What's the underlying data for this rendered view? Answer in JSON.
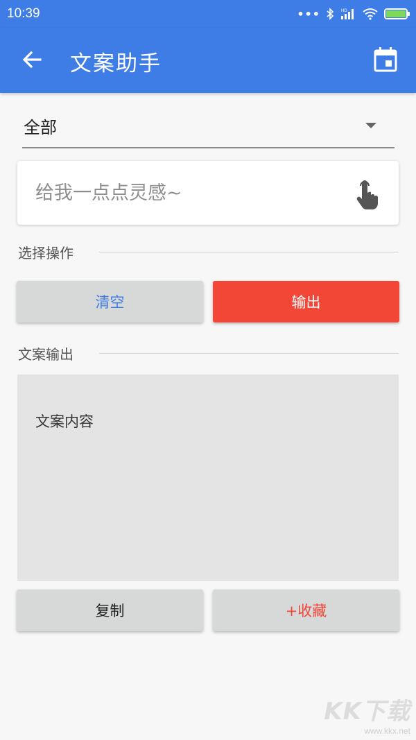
{
  "status_bar": {
    "time": "10:39",
    "dots": "•••",
    "icons": [
      "bluetooth-icon",
      "signal-icon",
      "wifi-icon",
      "battery-icon"
    ]
  },
  "app_bar": {
    "title": "文案助手",
    "back_icon": "arrow-left-icon",
    "action_icon": "calendar-icon",
    "color": "#3e7ce6"
  },
  "dropdown": {
    "selected": "全部"
  },
  "input": {
    "placeholder": "给我一点点灵感~",
    "value": "",
    "action_icon": "touch-icon"
  },
  "sections": {
    "operation_label": "选择操作",
    "output_label": "文案输出"
  },
  "buttons": {
    "clear": "清空",
    "output": "输出",
    "copy": "复制",
    "favorite": "+收藏"
  },
  "output": {
    "content": "文案内容"
  },
  "watermark": {
    "logo": "KK下载",
    "url": "www.kkx.net"
  },
  "colors": {
    "accent_blue": "#3e7ce6",
    "accent_red": "#f24637",
    "clear_text": "#3e7ce6",
    "favorite_text": "#f24637"
  }
}
